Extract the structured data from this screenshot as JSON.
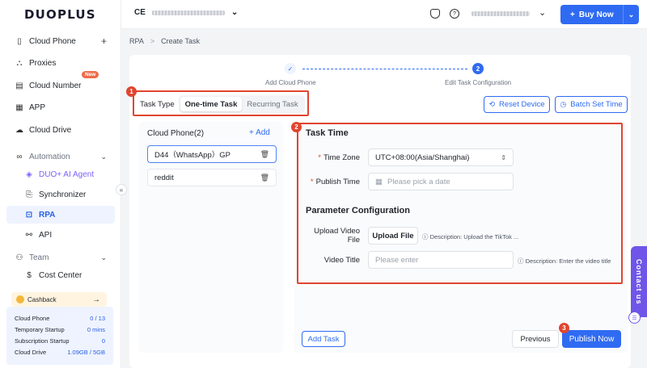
{
  "brand": {
    "logo": "DUOPLUS"
  },
  "sidebar": {
    "items": [
      {
        "label": "Cloud Phone",
        "icon": "phone-icon",
        "right": "+"
      },
      {
        "label": "Proxies",
        "icon": "proxies-icon"
      },
      {
        "label": "Cloud Number",
        "icon": "cloud-number-icon",
        "badge": "New"
      },
      {
        "label": "APP",
        "icon": "app-grid-icon"
      },
      {
        "label": "Cloud Drive",
        "icon": "cloud-icon"
      }
    ],
    "automation": {
      "label": "Automation",
      "children": [
        {
          "label": "DUO+ AI Agent",
          "icon": "ai-agent-icon"
        },
        {
          "label": "Synchronizer",
          "icon": "synchronizer-icon"
        },
        {
          "label": "RPA",
          "icon": "rpa-icon"
        },
        {
          "label": "API",
          "icon": "api-icon"
        }
      ]
    },
    "team": {
      "label": "Team",
      "children": [
        {
          "label": "Cost Center",
          "icon": "dollar-icon"
        }
      ]
    },
    "cashback": {
      "label": "Cashback",
      "arrow": "→"
    },
    "usage": [
      {
        "label": "Cloud Phone",
        "value": "0 / 13"
      },
      {
        "label": "Temporary Startup",
        "value": "0 mins"
      },
      {
        "label": "Subscription Startup",
        "value": "0"
      },
      {
        "label": "Cloud Drive",
        "value": "1.09GB / 5GB"
      }
    ],
    "collapse_glyph": "«"
  },
  "topbar": {
    "account_initials": "CE",
    "buy_now": "Buy Now"
  },
  "breadcrumb": {
    "parent": "RPA",
    "sep": ">",
    "current": "Create Task"
  },
  "steps": [
    {
      "label": "Add Cloud Phone",
      "marker": "✓"
    },
    {
      "label": "Edit Task Configuration",
      "marker": "2"
    }
  ],
  "task_type": {
    "label": "Task Type",
    "options": [
      "One-time Task",
      "Recurring Task"
    ],
    "selected": "One-time Task"
  },
  "actions": {
    "reset_device": "Reset Device",
    "batch_set_time": "Batch Set Time"
  },
  "phones": {
    "header": "Cloud Phone(2)",
    "add": "+ Add",
    "items": [
      "D44（WhatsApp）GP",
      "reddit"
    ]
  },
  "task_time": {
    "title": "Task Time",
    "time_zone_label": "Time Zone",
    "time_zone_value": "UTC+08:00(Asia/Shanghai)",
    "publish_time_label": "Publish Time",
    "publish_time_placeholder": "Please pick a date"
  },
  "params": {
    "title": "Parameter Configuration",
    "upload_video_label_1": "Upload Video",
    "upload_video_label_2": "File",
    "upload_button": "Upload File",
    "upload_desc": "Description: Upload the TikTok ...",
    "video_title_label": "Video Title",
    "video_title_placeholder": "Please enter",
    "video_title_desc": "Description: Enter the video title"
  },
  "footer": {
    "add_task": "Add Task",
    "previous": "Previous",
    "publish": "Publish Now"
  },
  "markers": [
    "1",
    "2",
    "3"
  ],
  "contact": {
    "label": "Contact us"
  },
  "colors": {
    "primary": "#2f6bf2",
    "annotation": "#e0452f",
    "contact": "#6f56e8",
    "badge": "#ef6b4a"
  }
}
